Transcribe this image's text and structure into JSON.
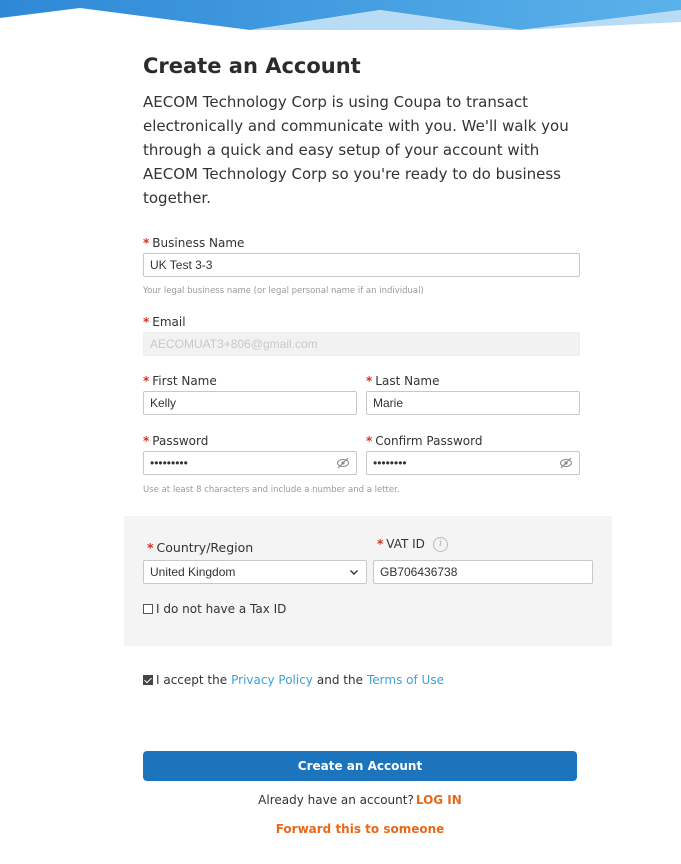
{
  "page_title": "Create an Account",
  "intro": "AECOM Technology Corp is using Coupa to transact electronically and communicate with you. We'll walk you through a quick and easy setup of your account with AECOM Technology Corp so you're ready to do business together.",
  "required_marker": "*",
  "fields": {
    "business_name": {
      "label": "Business Name",
      "value": "UK Test 3-3",
      "help": "Your legal business name (or legal personal name if an individual)"
    },
    "email": {
      "label": "Email",
      "value": "AECOMUAT3+806@gmail.com"
    },
    "first_name": {
      "label": "First Name",
      "value": "Kelly"
    },
    "last_name": {
      "label": "Last Name",
      "value": "Marie"
    },
    "password": {
      "label": "Password",
      "value": "•••••••••"
    },
    "confirm_password": {
      "label": "Confirm Password",
      "value": "••••••••"
    },
    "password_help": "Use at least 8 characters and include a number and a letter.",
    "country": {
      "label": "Country/Region",
      "value": "United Kingdom"
    },
    "vat_id": {
      "label": "VAT ID",
      "value": "GB706436738",
      "info_glyph": "i"
    }
  },
  "no_tax_id_label": "I do not have a Tax ID",
  "accept": {
    "prefix": "I accept the",
    "privacy_link": "Privacy Policy",
    "middle": "and the",
    "terms_link": "Terms of Use",
    "checked": true
  },
  "create_button": "Create an Account",
  "login": {
    "prefix": "Already have an account?",
    "link": "LOG IN"
  },
  "forward_link": "Forward this to someone",
  "icons": {
    "eye": "eye-slash-icon",
    "chevron": "chevron-down-icon",
    "info": "info-icon",
    "check": "checkbox-checked-icon"
  },
  "colors": {
    "primary": "#1c74bd",
    "link_blue": "#3f9fd8",
    "orange": "#e8681a",
    "required": "#d9301f"
  }
}
